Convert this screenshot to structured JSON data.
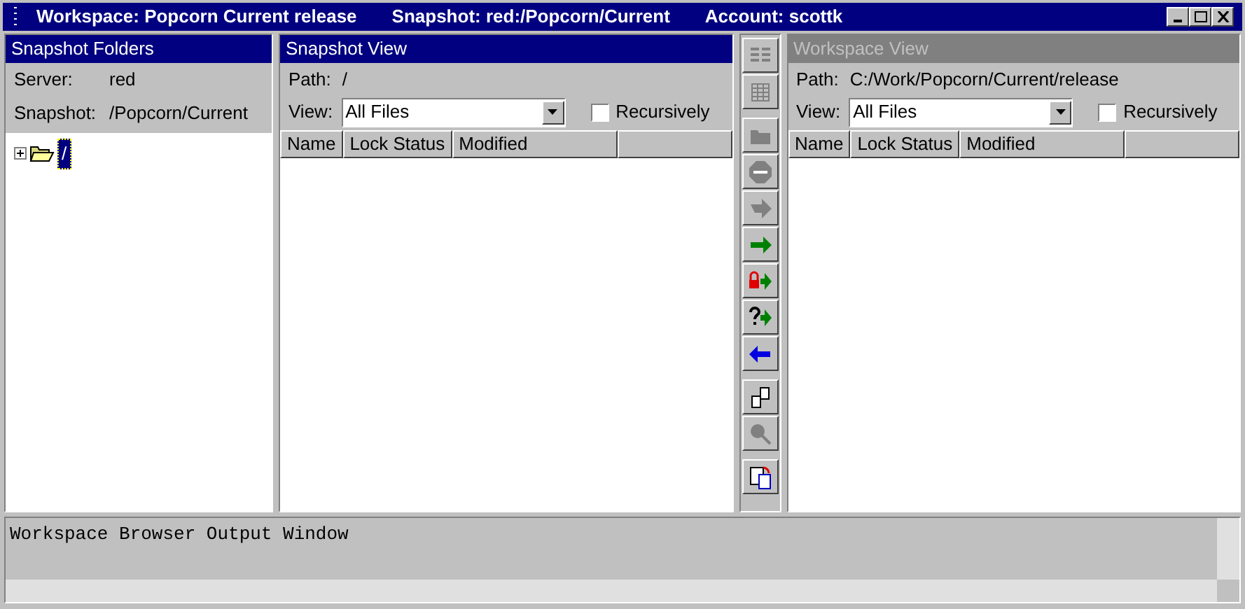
{
  "window": {
    "title_parts": [
      "Workspace:  Popcorn Current release",
      "Snapshot:  red:/Popcorn/Current",
      "Account:  scottk"
    ]
  },
  "folders": {
    "title": "Snapshot Folders",
    "active": true,
    "fields": [
      {
        "label": "Server:",
        "value": "red"
      },
      {
        "label": "Snapshot:",
        "value": "/Popcorn/Current"
      }
    ],
    "tree": [
      {
        "label": "/",
        "expanded": false,
        "selected": true
      }
    ]
  },
  "panes": [
    {
      "title": "Snapshot View",
      "active": true,
      "path_label": "Path:",
      "path": "/",
      "view_label": "View:",
      "view": "All Files",
      "recursive_label": "Recursively",
      "recursive": false,
      "columns": [
        "Name",
        "Lock Status",
        "Modified"
      ]
    },
    {
      "title": "Workspace View",
      "active": false,
      "path_label": "Path:",
      "path": "C:/Work/Popcorn/Current/release",
      "view_label": "View:",
      "view": "All Files",
      "recursive_label": "Recursively",
      "recursive": false,
      "columns": [
        "Name",
        "Lock Status",
        "Modified"
      ]
    }
  ],
  "tools": [
    {
      "kind": "details",
      "disabled": true
    },
    {
      "kind": "table",
      "disabled": true
    },
    {
      "kind": "folder",
      "disabled": true
    },
    {
      "kind": "stop",
      "disabled": true
    },
    {
      "kind": "checkout",
      "disabled": true
    },
    {
      "kind": "right",
      "disabled": false
    },
    {
      "kind": "lock",
      "disabled": false
    },
    {
      "kind": "query",
      "disabled": false
    },
    {
      "kind": "left",
      "disabled": false
    },
    {
      "kind": "copy",
      "disabled": false
    },
    {
      "kind": "search",
      "disabled": true
    },
    {
      "kind": "paste",
      "disabled": false
    }
  ],
  "output": {
    "text": "Workspace Browser Output Window"
  }
}
